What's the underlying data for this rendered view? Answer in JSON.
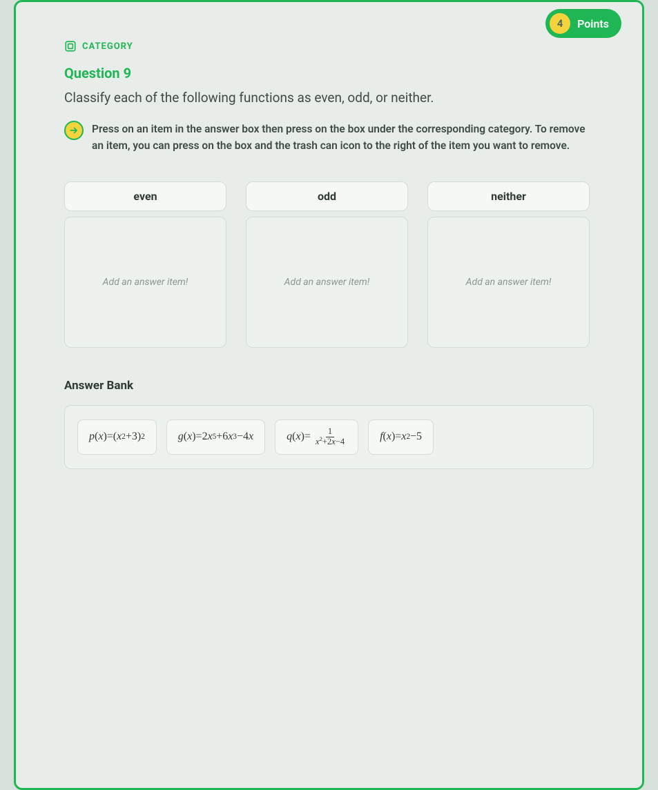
{
  "points": {
    "value": "4",
    "label": "Points"
  },
  "category_label": "CATEGORY",
  "question_title": "Question 9",
  "question_prompt": "Classify each of the following functions as even, odd, or neither.",
  "hint_text": "Press on an item in the answer box then press on the box under the corresponding category. To remove an item, you can press on the box and the trash can icon to the right of the item you want to remove.",
  "zones": {
    "even": {
      "label": "even",
      "placeholder": "Add an answer item!"
    },
    "odd": {
      "label": "odd",
      "placeholder": "Add an answer item!"
    },
    "neither": {
      "label": "neither",
      "placeholder": "Add an answer item!"
    }
  },
  "answer_bank": {
    "title": "Answer Bank",
    "items": {
      "p": "p(x)=(x²+3)²",
      "g": "g(x)=2x⁵+6x³−4x",
      "q_prefix": "q(x)=",
      "q_num": "1",
      "q_den": "x²+2x−4",
      "f": "f(x)=x²−5"
    }
  }
}
